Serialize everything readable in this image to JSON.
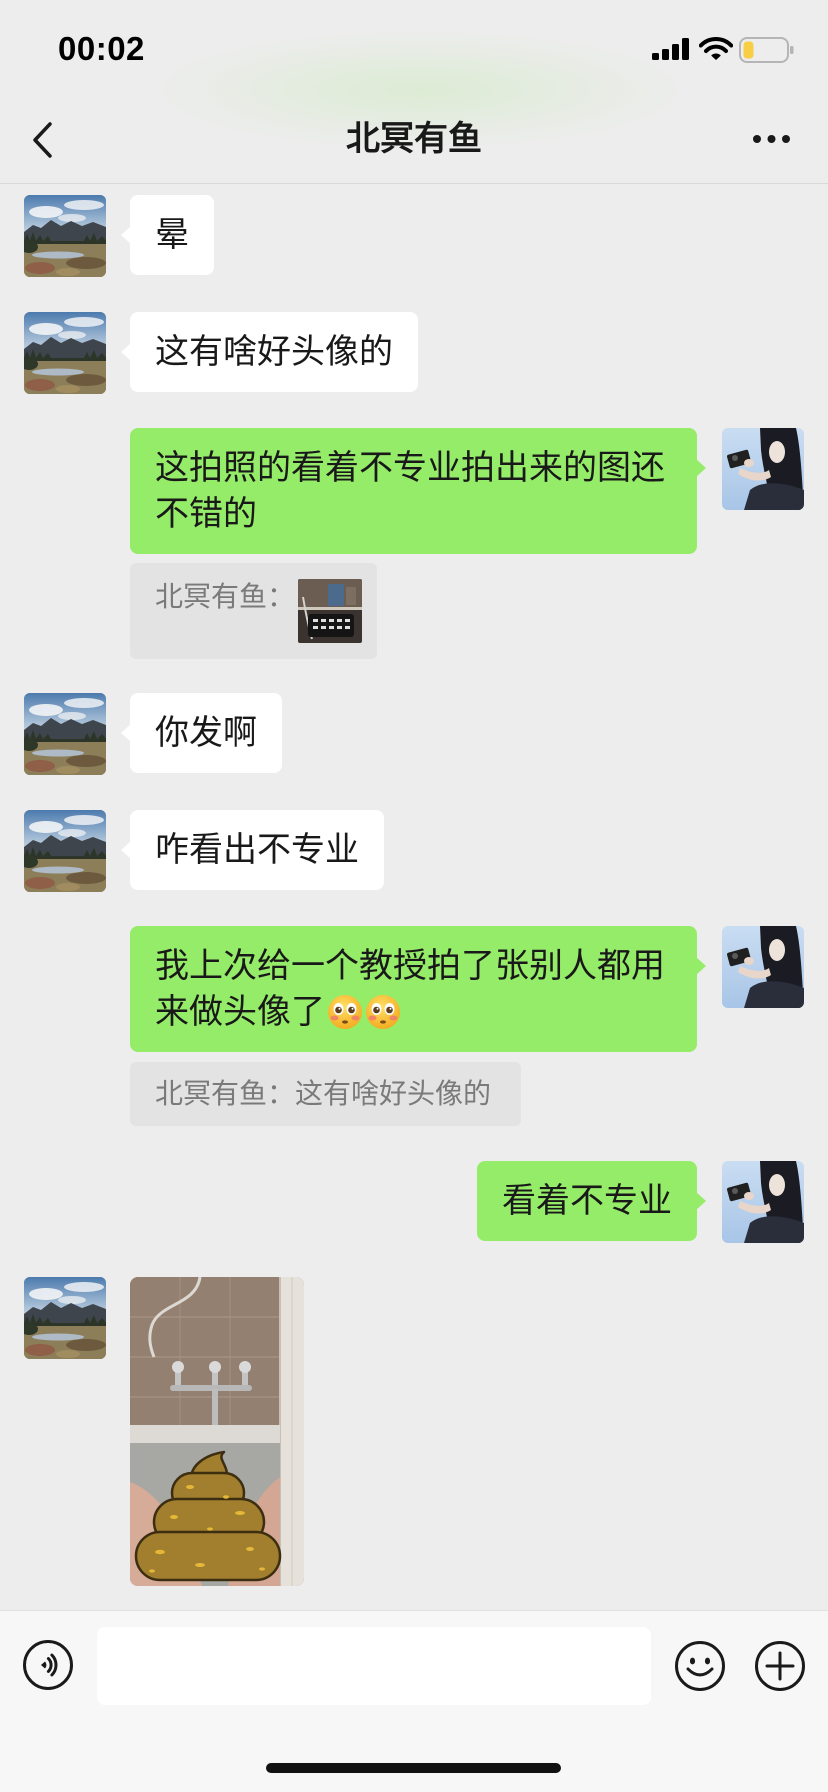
{
  "status_bar": {
    "time": "00:02",
    "icons": [
      "signal-icon",
      "wifi-icon",
      "battery-icon"
    ]
  },
  "nav": {
    "title": "北冥有鱼",
    "back_icon": "chevron-left-icon",
    "more_icon": "more-dots-icon"
  },
  "messages": [
    {
      "side": "left",
      "type": "text",
      "text": "晕"
    },
    {
      "side": "left",
      "type": "text",
      "text": "这有啥好头像的"
    },
    {
      "side": "right",
      "type": "text",
      "text": "这拍照的看着不专业拍出来的图还不错的",
      "quote": {
        "text": "北冥有鱼：",
        "thumbnail": true
      }
    },
    {
      "side": "left",
      "type": "text",
      "text": "你发啊"
    },
    {
      "side": "left",
      "type": "text",
      "text": "咋看出不专业"
    },
    {
      "side": "right",
      "type": "text",
      "text": "我上次给一个教授拍了张别人都用来做头像了",
      "emojis": [
        "flushed-face-emoji",
        "flushed-face-emoji"
      ],
      "quote": {
        "text": "北冥有鱼：这有啥好头像的"
      }
    },
    {
      "side": "right",
      "type": "text",
      "text": "看着不专业"
    },
    {
      "side": "left",
      "type": "image"
    }
  ],
  "input_bar": {
    "input_value": "",
    "icons": [
      "voice-icon",
      "emoji-smile-icon",
      "plus-icon"
    ]
  },
  "colors": {
    "chat_background": "#EDEDED",
    "bubble_self": "#95EC69",
    "bubble_other": "#FFFFFF",
    "quote_background": "#E3E3E3",
    "input_bar_background": "#F7F7F7",
    "battery_fill": "#F7CE46"
  }
}
